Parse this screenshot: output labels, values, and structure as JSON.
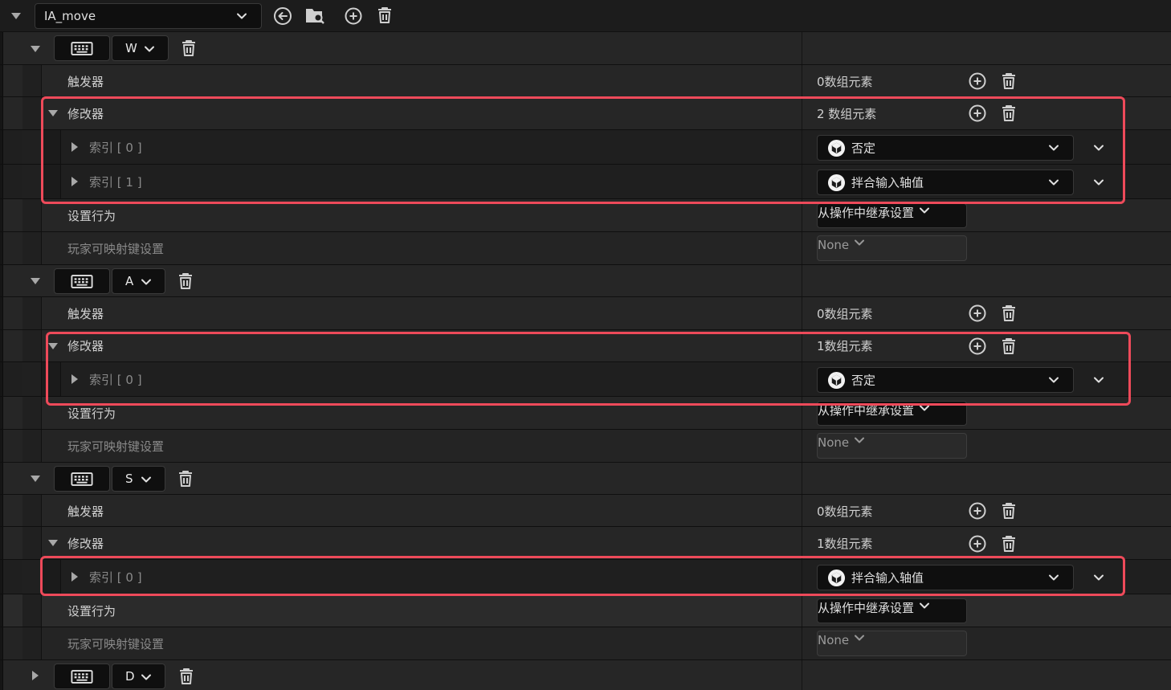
{
  "action": {
    "name": "IA_move"
  },
  "labels": {
    "triggers": "触发器",
    "modifiers": "修改器",
    "setting_behavior": "设置行为",
    "player_mappable": "玩家可映射键设置"
  },
  "mappings": [
    {
      "key": "W",
      "triggers_count": "0数组元素",
      "modifiers_count": "2 数组元素",
      "modifiers": [
        {
          "index": "索引 [ 0 ]",
          "value": "否定"
        },
        {
          "index": "索引 [ 1 ]",
          "value": "拌合输入轴值"
        }
      ],
      "behavior": "从操作中继承设置",
      "player_mappable": "None"
    },
    {
      "key": "A",
      "triggers_count": "0数组元素",
      "modifiers_count": "1数组元素",
      "modifiers": [
        {
          "index": "索引 [ 0 ]",
          "value": "否定"
        }
      ],
      "behavior": "从操作中继承设置",
      "player_mappable": "None"
    },
    {
      "key": "S",
      "triggers_count": "0数组元素",
      "modifiers_count": "1数组元素",
      "modifiers": [
        {
          "index": "索引 [ 0 ]",
          "value": "拌合输入轴值"
        }
      ],
      "behavior": "从操作中继承设置",
      "player_mappable": "None"
    },
    {
      "key": "D"
    }
  ],
  "colors": {
    "highlight": "#ee4a5a",
    "panel": "#262626",
    "field": "#0f0f0f"
  }
}
